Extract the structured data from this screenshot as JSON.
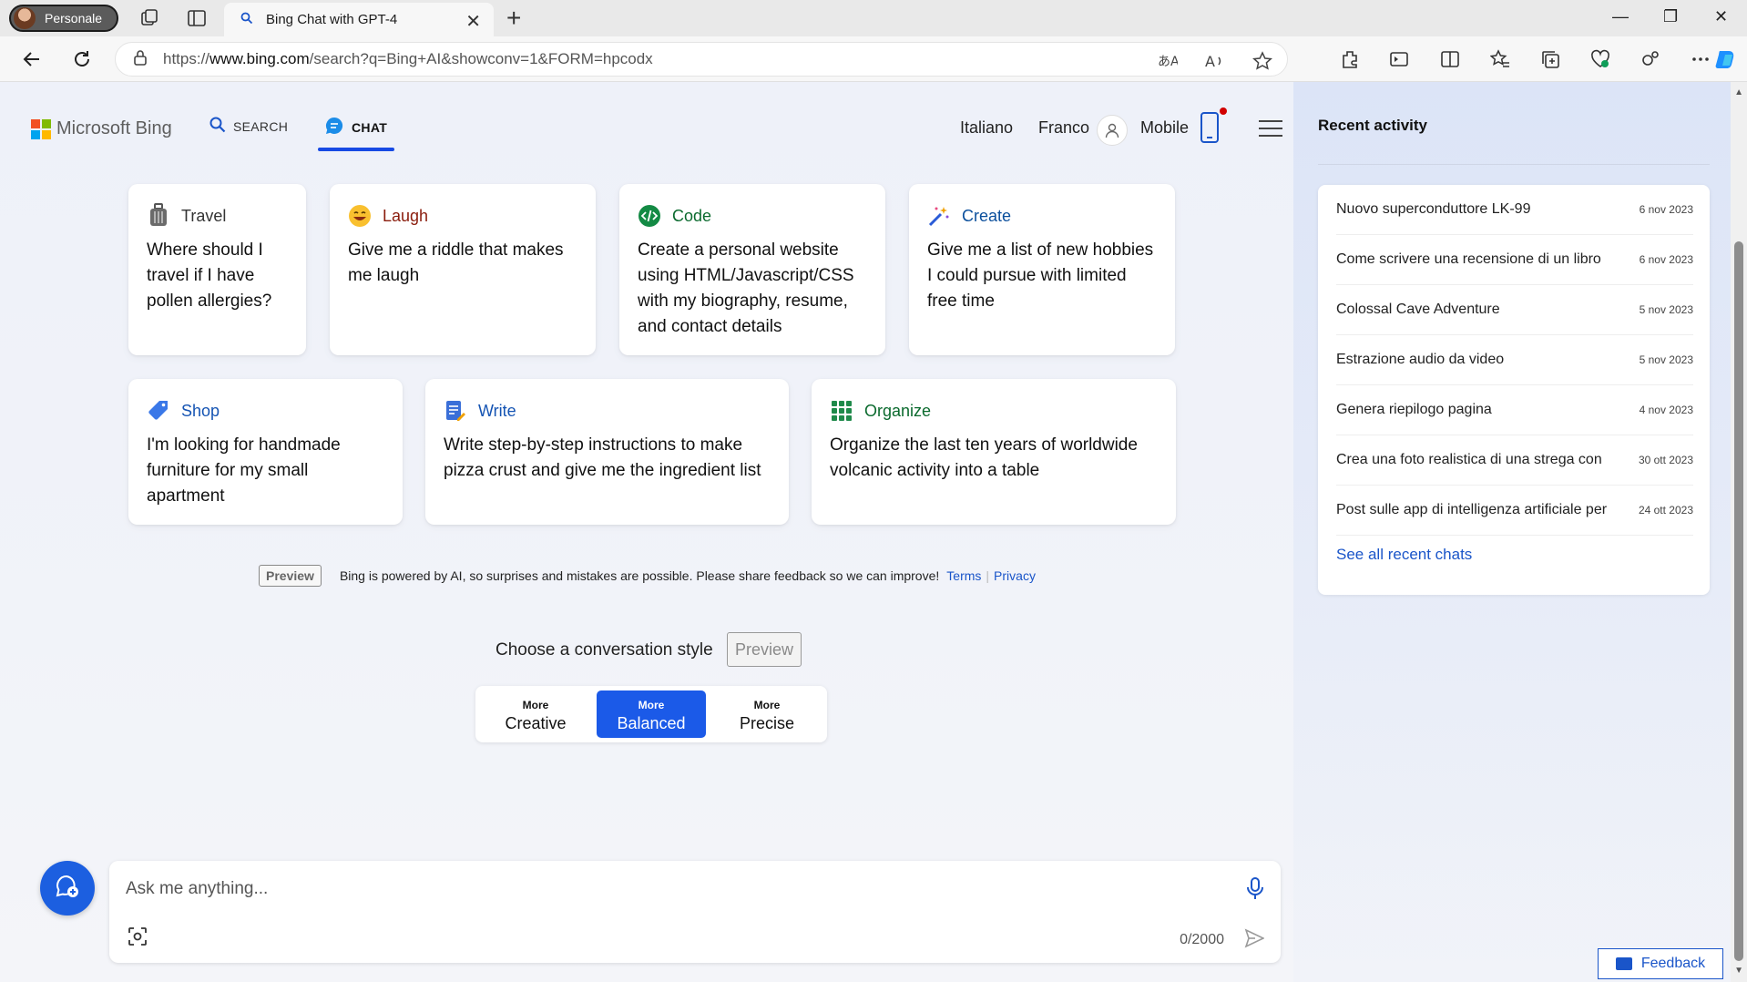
{
  "browser": {
    "profile_label": "Personale",
    "tab_title": "Bing Chat with GPT-4",
    "url_prefix": "https://",
    "url_host": "www.bing.com",
    "url_path": "/search?q=Bing+AI&showconv=1&FORM=hpcodx"
  },
  "header": {
    "logo_text": "Microsoft Bing",
    "nav_search": "SEARCH",
    "nav_chat": "CHAT",
    "language": "Italiano",
    "user_name": "Franco",
    "mobile_label": "Mobile"
  },
  "cards": [
    {
      "title": "Travel",
      "text": "Where should I travel if I have pollen allergies?",
      "color": "#333333"
    },
    {
      "title": "Laugh",
      "text": "Give me a riddle that makes me laugh",
      "color": "#8a1c0c"
    },
    {
      "title": "Code",
      "text": "Create a personal website using HTML/Javascript/CSS with my biography, resume, and contact details",
      "color": "#0b6a2e"
    },
    {
      "title": "Create",
      "text": "Give me a list of new hobbies I could pursue with limited free time",
      "color": "#0b4f9c"
    },
    {
      "title": "Shop",
      "text": "I'm looking for handmade furniture for my small apartment",
      "color": "#1554b3"
    },
    {
      "title": "Write",
      "text": "Write step-by-step instructions to make pizza crust and give me the ingredient list",
      "color": "#1554b3"
    },
    {
      "title": "Organize",
      "text": "Organize the last ten years of worldwide volcanic activity into a table",
      "color": "#0b6a2e"
    }
  ],
  "disclaimer": {
    "badge": "Preview",
    "text": "Bing is powered by AI, so surprises and mistakes are possible. Please share feedback so we can improve!",
    "terms": "Terms",
    "privacy": "Privacy"
  },
  "conversation_style": {
    "label": "Choose a conversation style",
    "preview": "Preview",
    "options": [
      {
        "top": "More",
        "bottom": "Creative",
        "selected": false
      },
      {
        "top": "More",
        "bottom": "Balanced",
        "selected": true
      },
      {
        "top": "More",
        "bottom": "Precise",
        "selected": false
      }
    ]
  },
  "input": {
    "placeholder": "Ask me anything...",
    "counter": "0/2000"
  },
  "recent": {
    "title": "Recent activity",
    "items": [
      {
        "title": "Nuovo superconduttore LK-99",
        "date": "6 nov 2023"
      },
      {
        "title": "Come scrivere una recensione di un libro",
        "date": "6 nov 2023"
      },
      {
        "title": "Colossal Cave Adventure",
        "date": "5 nov 2023"
      },
      {
        "title": "Estrazione audio da video",
        "date": "5 nov 2023"
      },
      {
        "title": "Genera riepilogo pagina",
        "date": "4 nov 2023"
      },
      {
        "title": "Crea una foto realistica di una strega con",
        "date": "30 ott 2023"
      },
      {
        "title": "Post sulle app di intelligenza artificiale per",
        "date": "24 ott 2023"
      }
    ],
    "see_all": "See all recent chats"
  },
  "feedback_label": "Feedback",
  "colors": {
    "accent": "#1b5ae8",
    "link": "#1a55c9"
  }
}
